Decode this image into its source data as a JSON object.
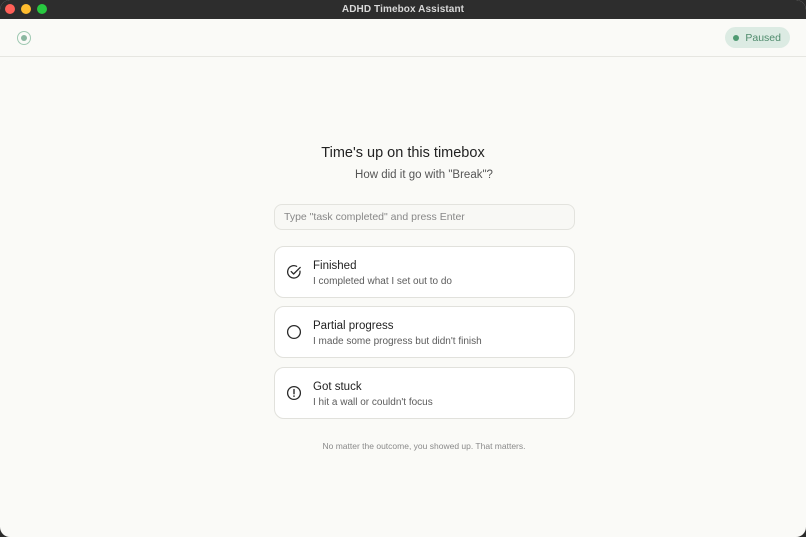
{
  "window": {
    "title": "ADHD Timebox Assistant"
  },
  "toolbar": {
    "logo_icon": "timer-circle-icon",
    "status": {
      "label": "Paused",
      "color": "#4f9a72"
    }
  },
  "main": {
    "heading": "Time's up on this timebox",
    "subheading": "How did it go with \"Break\"?",
    "input": {
      "placeholder": "Type \"task completed\" and press Enter",
      "value": ""
    },
    "options": [
      {
        "icon": "check-circle-icon",
        "title": "Finished",
        "description": "I completed what I set out to do"
      },
      {
        "icon": "empty-circle-icon",
        "title": "Partial progress",
        "description": "I made some progress but didn't finish"
      },
      {
        "icon": "alert-circle-icon",
        "title": "Got stuck",
        "description": "I hit a wall or couldn't focus"
      }
    ],
    "footnote": "No matter the outcome, you showed up. That matters."
  }
}
